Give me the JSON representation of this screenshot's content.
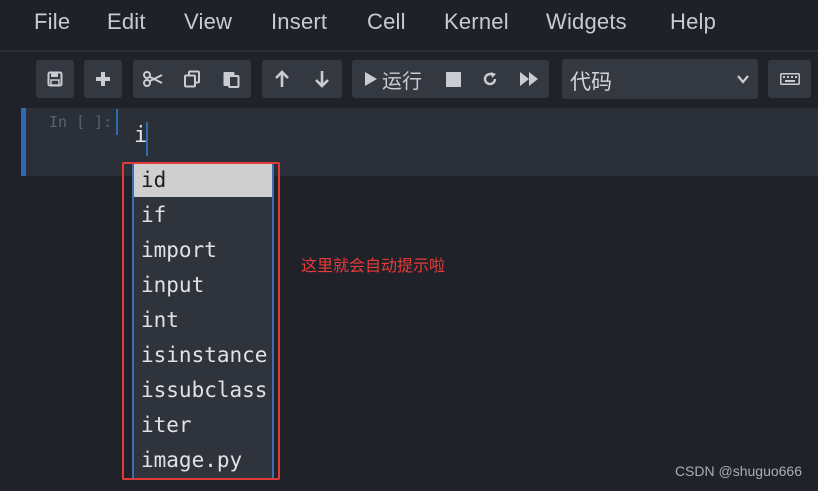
{
  "menubar": {
    "items": [
      "File",
      "Edit",
      "View",
      "Insert",
      "Cell",
      "Kernel",
      "Widgets",
      "Help"
    ]
  },
  "toolbar": {
    "icons": {
      "save": "save-icon",
      "add": "plus-icon",
      "cut": "scissors-icon",
      "copy": "copy-icon",
      "paste": "paste-icon",
      "move_up": "arrow-up-icon",
      "move_down": "arrow-down-icon",
      "run": "play-icon",
      "stop": "stop-icon",
      "restart": "restart-icon",
      "run_all": "fast-forward-icon",
      "keyboard": "keyboard-icon"
    },
    "run_label": "运行",
    "cell_type": "代码"
  },
  "cell": {
    "prompt": "In [ ]:",
    "code": "i"
  },
  "autocomplete": {
    "items": [
      "id",
      "if",
      "import",
      "input",
      "int",
      "isinstance",
      "issubclass",
      "iter",
      "image.py"
    ],
    "selected_index": 0
  },
  "annotation": {
    "text": "这里就会自动提示啦",
    "color": "#e83a3a"
  },
  "watermark": "CSDN @shuguo666",
  "colors": {
    "background": "#1f2229",
    "accent": "#2f6bb5",
    "highlight_box": "#e03a3a"
  }
}
